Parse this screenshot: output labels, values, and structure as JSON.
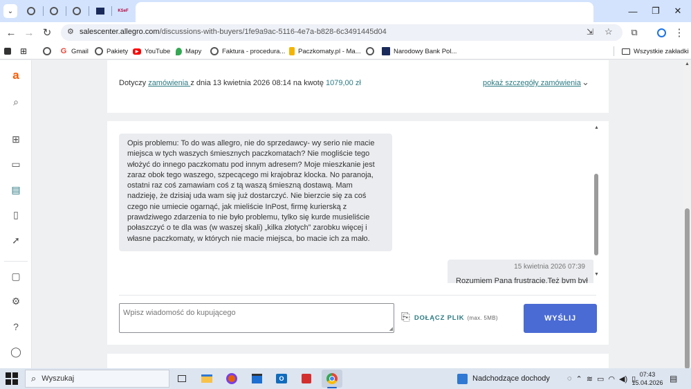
{
  "browser": {
    "tabs": [
      {
        "icon": "globe-icon"
      },
      {
        "icon": "globe-icon"
      },
      {
        "icon": "globe-icon"
      },
      {
        "icon": "nbp-icon"
      },
      {
        "icon": "ksef-icon",
        "label": "KSeF"
      }
    ],
    "window_controls": {
      "minimize": "—",
      "restore": "❐",
      "close": "✕"
    },
    "url_host": "salescenter.allegro.com",
    "url_path": "/discussions-with-buyers/1fe9a9ac-5116-4e7a-b828-6c3491445d04",
    "bookmarks": [
      {
        "label": "Gmail",
        "color": "#ea4335",
        "icon": "gmail-icon"
      },
      {
        "label": "Pakiety",
        "color": "#555555",
        "icon": "globe-icon"
      },
      {
        "label": "YouTube",
        "color": "#ff0000",
        "icon": "youtube-icon"
      },
      {
        "label": "Mapy",
        "color": "#34a853",
        "icon": "maps-icon"
      },
      {
        "label": "Faktura - procedura...",
        "color": "#555555",
        "icon": "globe-icon"
      },
      {
        "label": "Paczkomaty.pl - Ma...",
        "color": "#f4b400",
        "icon": "paczkomaty-icon"
      },
      {
        "label": "",
        "color": "#555555",
        "icon": "globe-icon"
      },
      {
        "label": "Narodowy Bank Pol...",
        "color": "#1a2a5a",
        "icon": "nbp-icon"
      }
    ],
    "all_bookmarks": "Wszystkie zakładki"
  },
  "order": {
    "prefix": "Dotyczy ",
    "link": "zamówienia ",
    "middle": "z dnia 13 kwietnia 2026 08:14 na kwotę ",
    "amount": "1079,00 zł",
    "details_link": "pokaż szczegóły zamówienia"
  },
  "messages": {
    "buyer": "Opis problemu: To do was allegro, nie do sprzedawcy- wy serio nie macie miejsca w tych waszych śmiesznych paczkomatach? Nie mogliście tego włożyć do innego paczkomatu pod innym adresem? Moje mieszkanie jest zaraz obok tego waszego, szpecącego mi krajobraz klocka. No paranoja, ostatni raz coś zamawiam coś z tą waszą śmieszną dostawą. Mam nadzieję, że dzisiaj uda wam się już dostarczyć. Nie bierzcie się za coś czego nie umiecie ogarnąć, jak mieliście InPost, firmę kurierską z prawdziwego zdarzenia to nie było problemu, tylko się kurde musieliście połaszczyć o te dla was (w waszej skali) „kilka złotych” zarobku więcej i własne paczkomaty, w których nie macie miejsca, bo macie ich za mało.",
    "seller_time": "15 kwietnia 2026 07:39",
    "seller_text": "Rozumiem Pana frustrację.Też bym był"
  },
  "reply": {
    "placeholder": "Wpisz wiadomość do kupującego",
    "attach_label": "DOŁĄCZ PLIK",
    "attach_size": "(max. 5MB)",
    "send_label": "WYŚLIJ"
  },
  "taskbar": {
    "search_label": "Wyszukaj",
    "weather": "Nadchodzące dochody",
    "time": "07:43",
    "date": "15.04.2026"
  },
  "colors": {
    "accent": "#2d7b83",
    "send_button": "#4a6bd4",
    "allegro_brand": "#ff5a00"
  }
}
